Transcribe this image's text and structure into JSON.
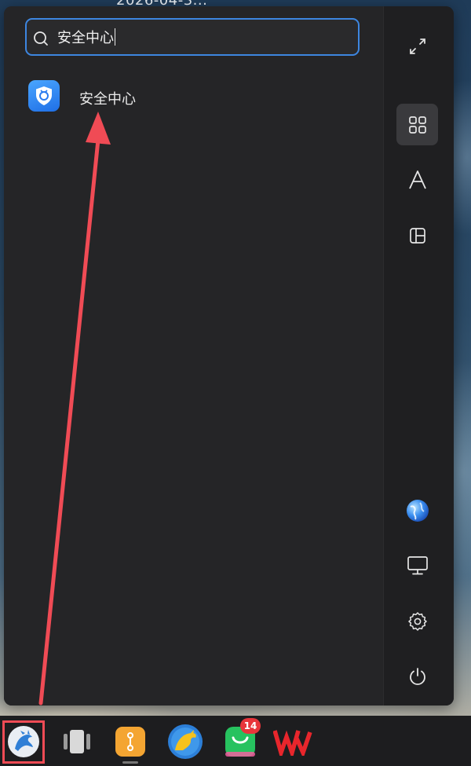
{
  "wallpaper": {
    "date_text": "2026-04-3..."
  },
  "search": {
    "query": "安全中心"
  },
  "results": [
    {
      "label": "安全中心",
      "icon": "shield-icon"
    }
  ],
  "sidebar": [
    {
      "name": "fullscreen-icon",
      "active": false
    },
    {
      "name": "all-apps-grid-icon",
      "active": true
    },
    {
      "name": "letter-sort-icon",
      "active": false
    },
    {
      "name": "category-layout-icon",
      "active": false
    },
    {
      "name": "browser-globe-icon",
      "active": false
    },
    {
      "name": "monitor-icon",
      "active": false
    },
    {
      "name": "settings-gear-icon",
      "active": false
    },
    {
      "name": "power-icon",
      "active": false
    }
  ],
  "taskbar": {
    "items": [
      "system-menu-icon",
      "multitask-view-icon",
      "transfer-app-icon",
      "browser-app-icon",
      "wechat-icon",
      "wps-icon"
    ],
    "wechat_badge": "14"
  },
  "colors": {
    "accent": "#3d86e0",
    "highlight_red": "#f04b55",
    "panel": "#232325"
  }
}
